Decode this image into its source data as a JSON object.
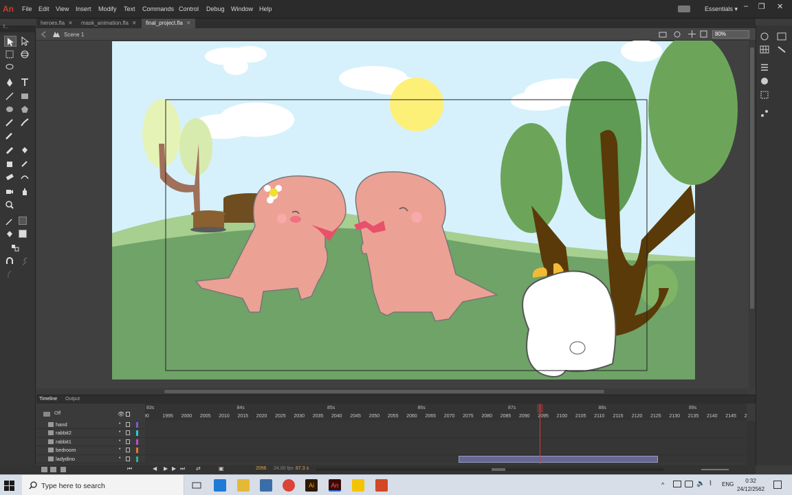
{
  "app": {
    "logo": "An"
  },
  "menu": [
    "File",
    "Edit",
    "View",
    "Insert",
    "Modify",
    "Text",
    "Commands",
    "Control",
    "Debug",
    "Window",
    "Help"
  ],
  "workspace": "Essentials ▾",
  "window_controls": {
    "minimize": "–",
    "restore": "❐",
    "close": "✕"
  },
  "doc_tabs": [
    {
      "label": "heroes.fla",
      "active": false
    },
    {
      "label": "mask_animation.fla",
      "active": false
    },
    {
      "label": "final_project.fla",
      "active": true
    }
  ],
  "editbar": {
    "scene": "Scene 1",
    "zoom": "80%"
  },
  "toolpanel": {
    "header": "T..."
  },
  "timeline": {
    "tabs": [
      "Timeline",
      "Output"
    ],
    "header_label": "Off",
    "seconds": [
      "83s",
      "84s",
      "85s",
      "86s",
      "87s",
      "88s",
      "89s"
    ],
    "frames": [
      "90",
      "1995",
      "2000",
      "2005",
      "2010",
      "2015",
      "2020",
      "2025",
      "2030",
      "2035",
      "2040",
      "2045",
      "2050",
      "2055",
      "2060",
      "2065",
      "2070",
      "2075",
      "2080",
      "2085",
      "2090",
      "2095",
      "2100",
      "2105",
      "2110",
      "2115",
      "2120",
      "2125",
      "2130",
      "2135",
      "2140",
      "2145",
      "2"
    ],
    "layers": [
      {
        "name": "hand",
        "color": "#7b5bd6"
      },
      {
        "name": "rabbit2",
        "color": "#27d0d0"
      },
      {
        "name": "rabbit1",
        "color": "#c04bd0"
      },
      {
        "name": "bedroom",
        "color": "#e07a2b"
      },
      {
        "name": "ladydino",
        "color": "#2bb0a0"
      }
    ],
    "current_frame": "2096",
    "fps": "24.00 fps",
    "elapsed": "87.3 s"
  },
  "taskbar": {
    "search_placeholder": "Type here to search",
    "time": "0:32",
    "date": "24/12/2562",
    "lang": "ENG"
  }
}
